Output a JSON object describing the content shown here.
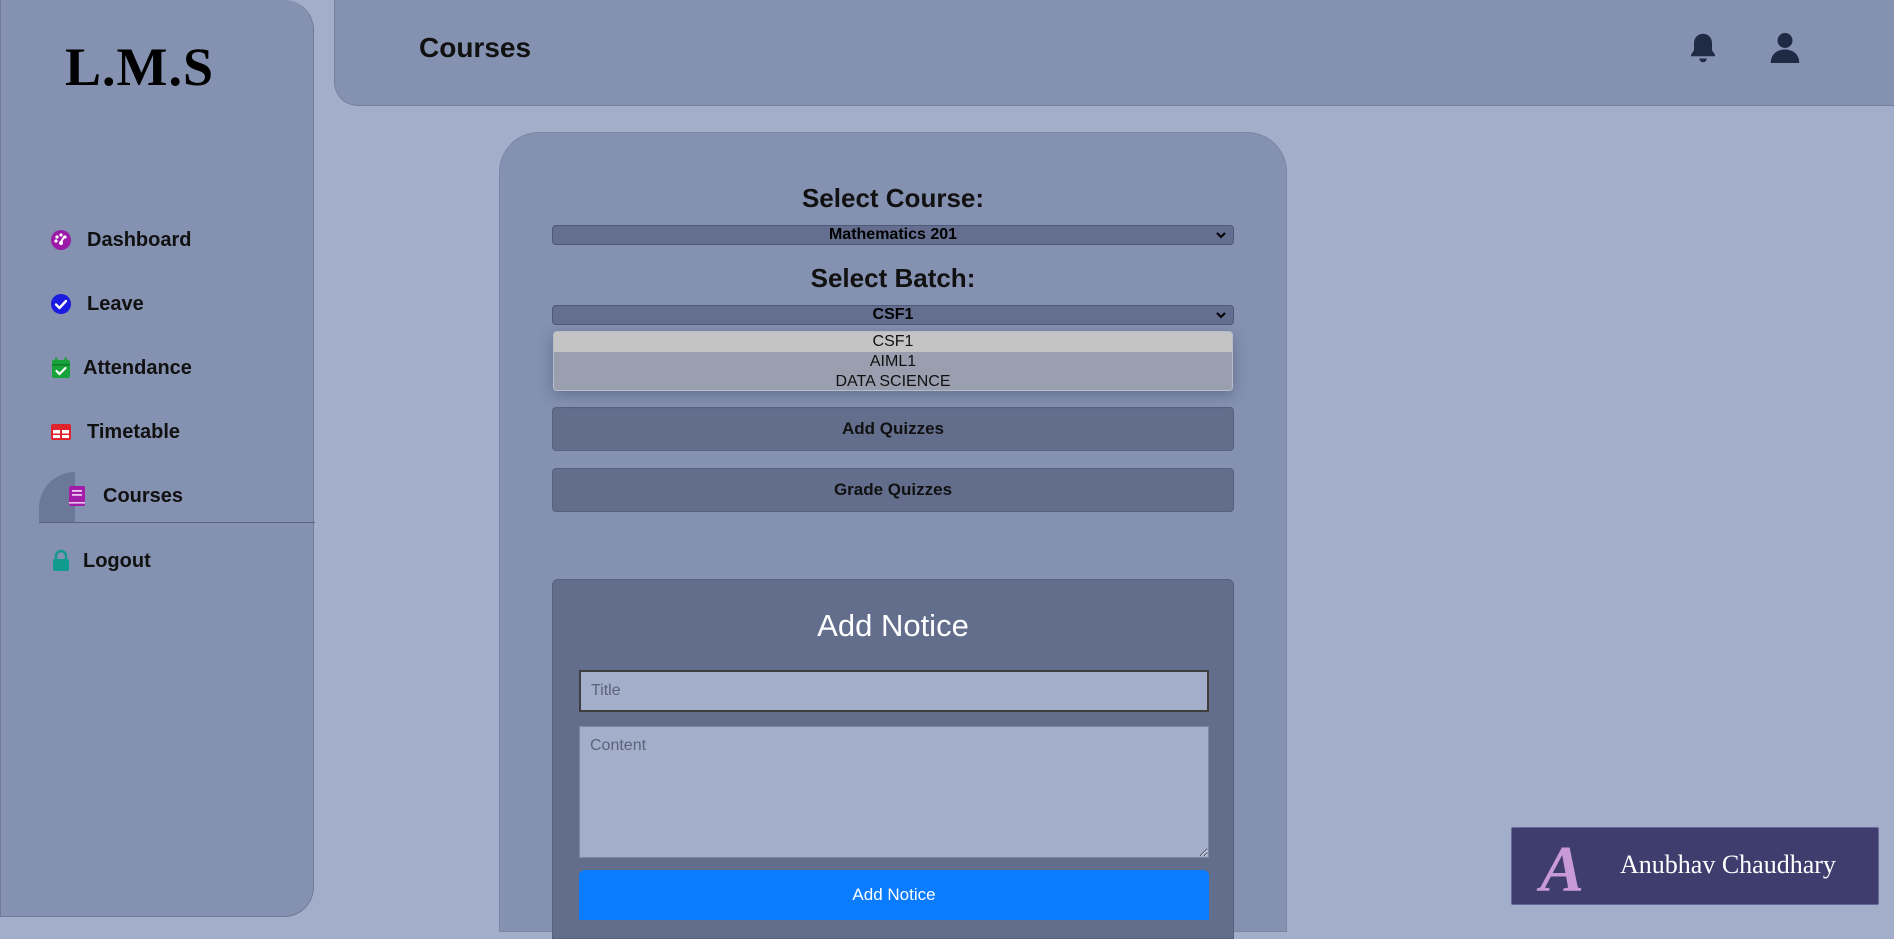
{
  "sidebar": {
    "logo": "L.M.S",
    "items": [
      {
        "label": "Dashboard",
        "icon": "dashboard-icon",
        "color": "#9b1aa8"
      },
      {
        "label": "Leave",
        "icon": "check-circle-icon",
        "color": "#1a1ae0"
      },
      {
        "label": "Attendance",
        "icon": "calendar-check-icon",
        "color": "#18a33a"
      },
      {
        "label": "Timetable",
        "icon": "table-icon",
        "color": "#e0242e"
      },
      {
        "label": "Courses",
        "icon": "book-icon",
        "color": "#a21ca8",
        "active": true
      },
      {
        "label": "Logout",
        "icon": "lock-icon",
        "color": "#0f9b8e"
      }
    ]
  },
  "header": {
    "title": "Courses",
    "icons": [
      "bell-icon",
      "user-icon"
    ]
  },
  "form": {
    "course_label": "Select Course:",
    "course_value": "Mathematics 201",
    "batch_label": "Select Batch:",
    "batch_value": "CSF1",
    "batch_options": [
      "CSF1",
      "AIML1",
      "DATA SCIENCE"
    ],
    "add_quizzes": "Add Quizzes",
    "grade_quizzes": "Grade Quizzes"
  },
  "notice": {
    "heading": "Add Notice",
    "title_placeholder": "Title",
    "content_placeholder": "Content",
    "submit": "Add Notice"
  },
  "badge": {
    "logo": "A",
    "name": "Anubhav Chaudhary"
  },
  "colors": {
    "accent": "#0a7cff",
    "panel": "#8491b0",
    "background": "#a3aecb"
  }
}
